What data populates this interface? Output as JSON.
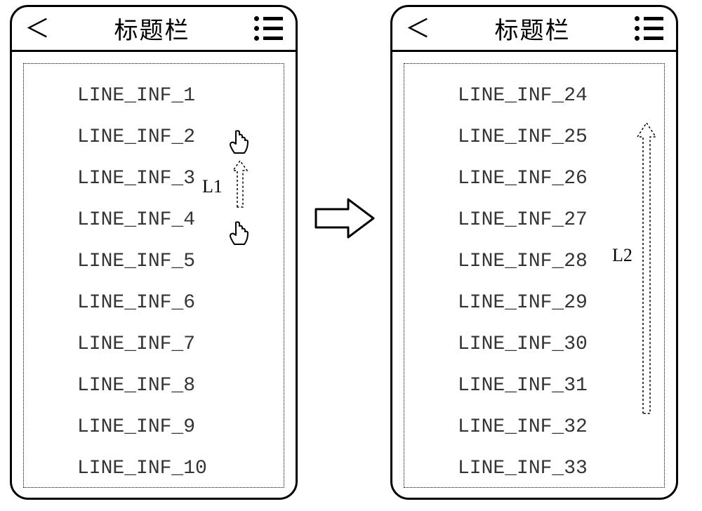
{
  "header": {
    "title": "标题栏",
    "back_glyph": "＜"
  },
  "labels": {
    "L1": "L1",
    "L2": "L2"
  },
  "left_list": [
    "LINE_INF_1",
    "LINE_INF_2",
    "LINE_INF_3",
    "LINE_INF_4",
    "LINE_INF_5",
    "LINE_INF_6",
    "LINE_INF_7",
    "LINE_INF_8",
    "LINE_INF_9",
    "LINE_INF_10"
  ],
  "right_list": [
    "LINE_INF_24",
    "LINE_INF_25",
    "LINE_INF_26",
    "LINE_INF_27",
    "LINE_INF_28",
    "LINE_INF_29",
    "LINE_INF_30",
    "LINE_INF_31",
    "LINE_INF_32",
    "LINE_INF_33"
  ]
}
